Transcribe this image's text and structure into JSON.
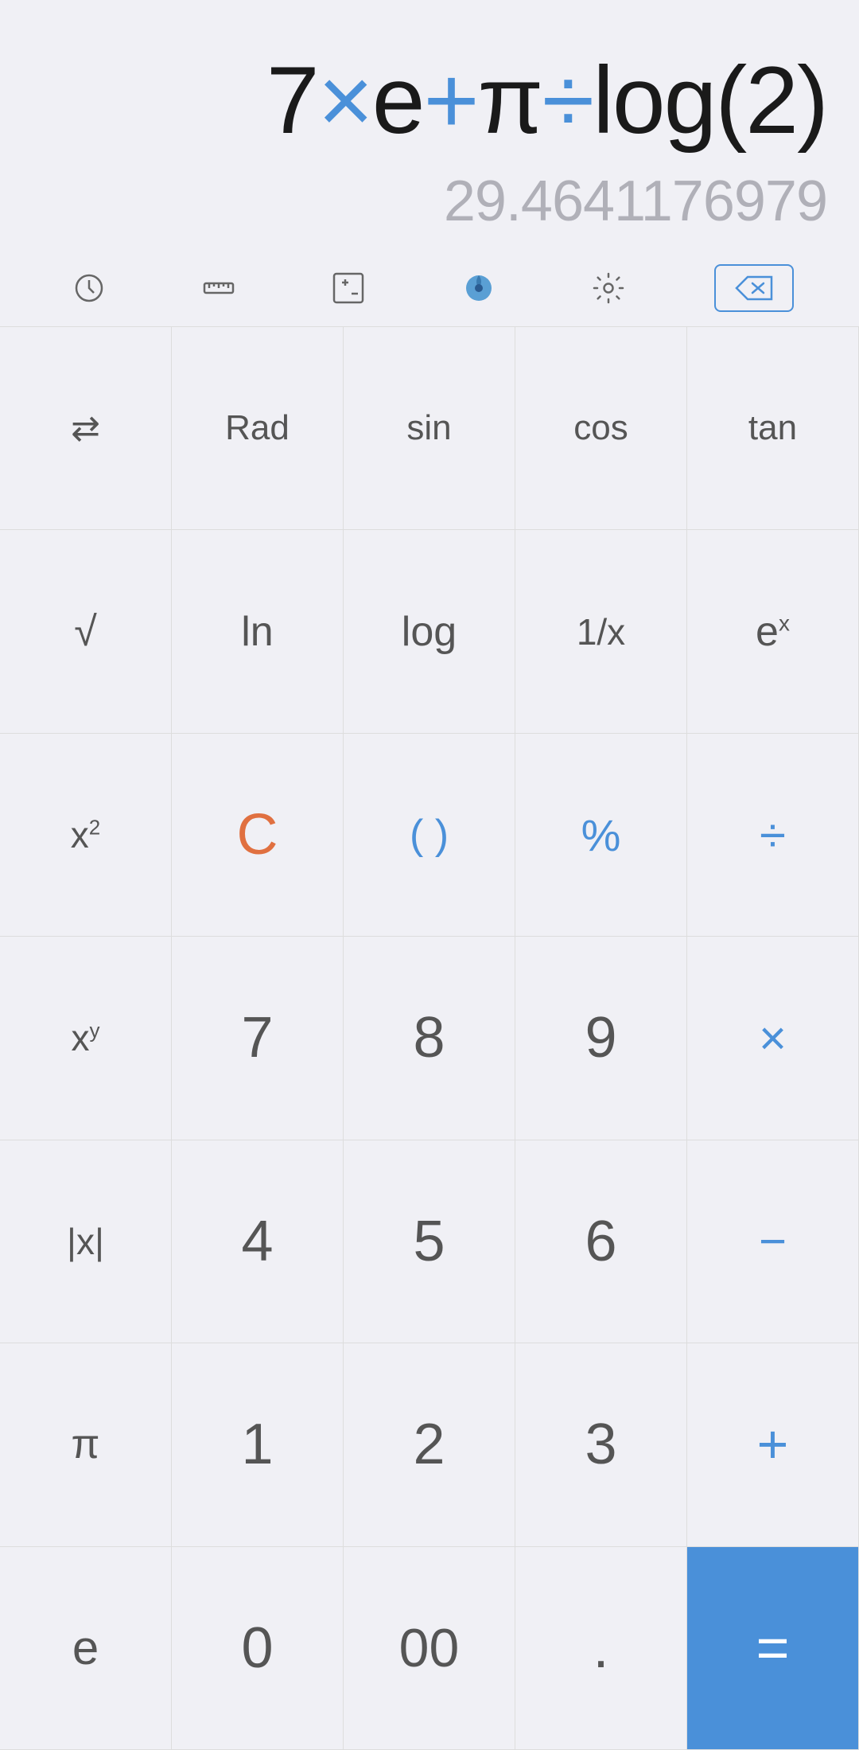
{
  "display": {
    "expression": "7×e+π÷log(2)",
    "result": "29.4641176979"
  },
  "toolbar": {
    "icons": [
      {
        "name": "history-icon",
        "label": "History"
      },
      {
        "name": "ruler-icon",
        "label": "Ruler"
      },
      {
        "name": "plusminus-icon",
        "label": "Plus Minus"
      },
      {
        "name": "theme-icon",
        "label": "Theme"
      },
      {
        "name": "settings-icon",
        "label": "Settings"
      },
      {
        "name": "backspace-icon",
        "label": "Backspace"
      }
    ]
  },
  "buttons": {
    "row1": [
      {
        "label": "⇄",
        "name": "swap-btn",
        "color": "normal"
      },
      {
        "label": "Rad",
        "name": "rad-btn",
        "color": "normal"
      },
      {
        "label": "sin",
        "name": "sin-btn",
        "color": "normal"
      },
      {
        "label": "cos",
        "name": "cos-btn",
        "color": "normal"
      },
      {
        "label": "tan",
        "name": "tan-btn",
        "color": "normal"
      }
    ],
    "row2": [
      {
        "label": "√",
        "name": "sqrt-btn",
        "color": "normal"
      },
      {
        "label": "ln",
        "name": "ln-btn",
        "color": "normal"
      },
      {
        "label": "log",
        "name": "log-btn",
        "color": "normal"
      },
      {
        "label": "1/x",
        "name": "reciprocal-btn",
        "color": "normal"
      },
      {
        "label": "eˣ",
        "name": "exp-btn",
        "color": "normal"
      }
    ],
    "row3": [
      {
        "label": "x²",
        "name": "square-btn",
        "color": "normal"
      },
      {
        "label": "C",
        "name": "clear-btn",
        "color": "orange"
      },
      {
        "label": "( )",
        "name": "paren-btn",
        "color": "blue"
      },
      {
        "label": "%",
        "name": "percent-btn",
        "color": "blue"
      },
      {
        "label": "÷",
        "name": "divide-btn",
        "color": "blue"
      }
    ],
    "row4": [
      {
        "label": "xʸ",
        "name": "power-btn",
        "color": "normal"
      },
      {
        "label": "7",
        "name": "seven-btn",
        "color": "normal"
      },
      {
        "label": "8",
        "name": "eight-btn",
        "color": "normal"
      },
      {
        "label": "9",
        "name": "nine-btn",
        "color": "normal"
      },
      {
        "label": "×",
        "name": "multiply-btn",
        "color": "blue"
      }
    ],
    "row5": [
      {
        "label": "|x|",
        "name": "abs-btn",
        "color": "normal"
      },
      {
        "label": "4",
        "name": "four-btn",
        "color": "normal"
      },
      {
        "label": "5",
        "name": "five-btn",
        "color": "normal"
      },
      {
        "label": "6",
        "name": "six-btn",
        "color": "normal"
      },
      {
        "label": "−",
        "name": "minus-btn",
        "color": "blue"
      }
    ],
    "row6": [
      {
        "label": "π",
        "name": "pi-btn",
        "color": "normal"
      },
      {
        "label": "1",
        "name": "one-btn",
        "color": "normal"
      },
      {
        "label": "2",
        "name": "two-btn",
        "color": "normal"
      },
      {
        "label": "3",
        "name": "three-btn",
        "color": "normal"
      },
      {
        "label": "+",
        "name": "plus-btn",
        "color": "blue"
      }
    ],
    "row7": [
      {
        "label": "e",
        "name": "euler-btn",
        "color": "normal"
      },
      {
        "label": "0",
        "name": "zero-btn",
        "color": "normal"
      },
      {
        "label": "00",
        "name": "doublezero-btn",
        "color": "normal"
      },
      {
        "label": ".",
        "name": "decimal-btn",
        "color": "normal"
      },
      {
        "label": "=",
        "name": "equals-btn",
        "color": "equals"
      }
    ]
  }
}
